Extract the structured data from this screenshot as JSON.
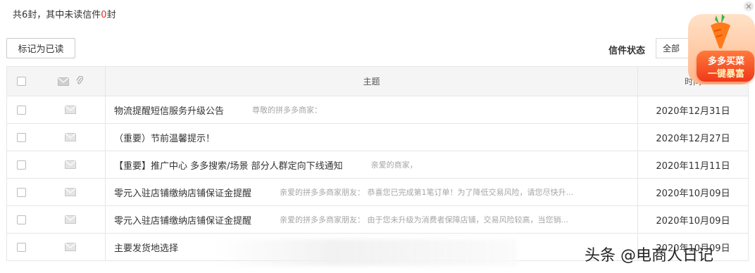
{
  "summary": {
    "prefix": "共6封，其中未读信件",
    "unread": "0",
    "suffix": "封"
  },
  "toolbar": {
    "mark_read_label": "标记为已读"
  },
  "filter": {
    "label": "信件状态",
    "selected": "全部"
  },
  "table": {
    "headers": {
      "subject": "主题",
      "time": "时间"
    },
    "rows": [
      {
        "subject": "物流提醒短信服务升级公告",
        "preview": "尊敬的拼多多商家：",
        "time": "2020年12月31日"
      },
      {
        "subject": "（重要）节前温馨提示！",
        "preview": "",
        "time": "2020年12月27日"
      },
      {
        "subject": "【重要】推广中心 多多搜索/场景 部分人群定向下线通知",
        "preview": "亲爱的商家，",
        "time": "2020年11月11日"
      },
      {
        "subject": "零元入驻店铺缴纳店铺保证金提醒",
        "preview": "亲爱的拼多多商家朋友：  恭喜您已完成第1笔订单！为了降低交易风险，请您尽快升...",
        "time": "2020年10月09日"
      },
      {
        "subject": "零元入驻店铺缴纳店铺保证金提醒",
        "preview": "亲爱的拼多多商家朋友：  由于您未升级为消费者保障店铺，交易风险较高，当您销...",
        "time": "2020年10月09日"
      },
      {
        "subject": "主要发货地选择",
        "preview": "",
        "time": "2020年10月09日"
      }
    ]
  },
  "promo": {
    "line1": "多多买菜",
    "line2": "一键暴富"
  },
  "watermark": {
    "text": "头条 @电商人日记"
  },
  "colors": {
    "accent": "#e02e24",
    "border": "#e6e6e6",
    "header_bg": "#f5f5f5"
  }
}
